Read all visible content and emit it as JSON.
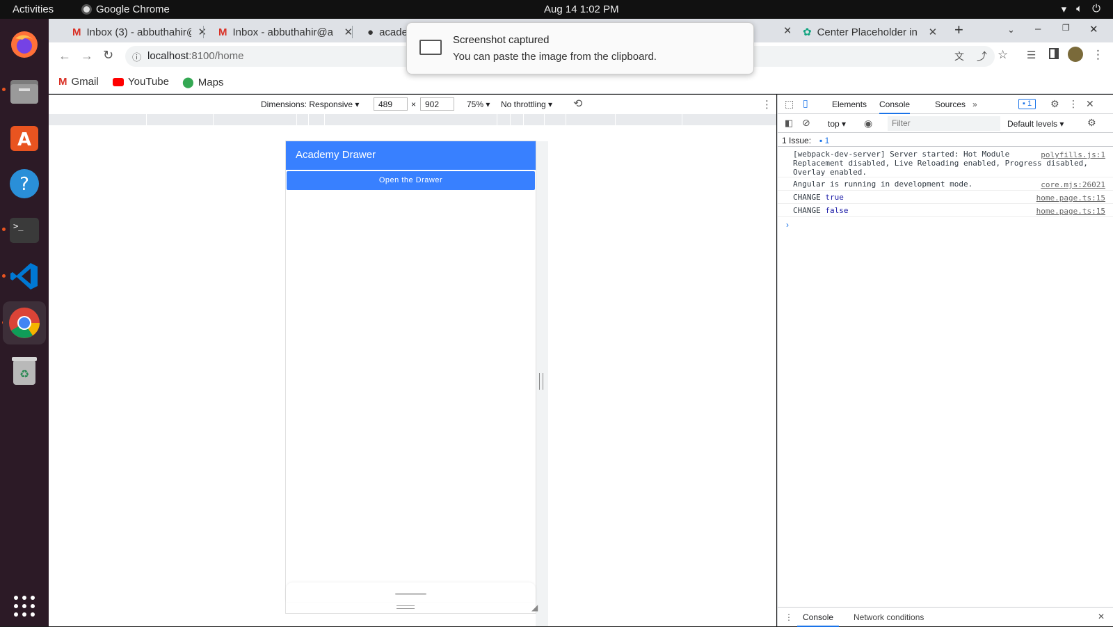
{
  "system": {
    "activities": "Activities",
    "app_name": "Google Chrome",
    "clock": "Aug 14  1:02 PM"
  },
  "notification": {
    "title": "Screenshot captured",
    "body": "You can paste the image from the clipboard."
  },
  "tabs": [
    {
      "label": "Inbox (3) - abbuthahir@a"
    },
    {
      "label": "Inbox - abbuthahir@a"
    },
    {
      "label": "academy"
    },
    {
      "label": "Center Placeholder in"
    }
  ],
  "omnibox": {
    "host": "localhost",
    "path": ":8100/home"
  },
  "bookmarks": [
    {
      "label": "Gmail"
    },
    {
      "label": "YouTube"
    },
    {
      "label": "Maps"
    }
  ],
  "device_toolbar": {
    "dimensions": "Dimensions: Responsive",
    "width": "489",
    "height": "902",
    "times": "×",
    "zoom": "75%",
    "throttling": "No throttling"
  },
  "app": {
    "header_title": "Academy Drawer",
    "open_button": "Open the Drawer"
  },
  "devtools": {
    "tabs": [
      "Elements",
      "Console",
      "Sources"
    ],
    "issue_badge_count": "1",
    "context": "top",
    "filter_placeholder": "Filter",
    "levels": "Default levels",
    "issues_label": "1 Issue:",
    "issues_count": "1",
    "logs": [
      {
        "text1": "[webpack-dev-server] Server started: Hot Module",
        "text2": "Replacement disabled, Live Reloading enabled, Progress disabled,",
        "text3": "Overlay enabled.",
        "source": "polyfills.js:1"
      },
      {
        "text": "Angular is running in development mode.",
        "source": "core.mjs:26021"
      },
      {
        "label": "CHANGE",
        "value": "true",
        "source": "home.page.ts:15"
      },
      {
        "label": "CHANGE",
        "value": "false",
        "source": "home.page.ts:15"
      }
    ],
    "drawer_tabs": [
      "Console",
      "Network conditions"
    ]
  }
}
